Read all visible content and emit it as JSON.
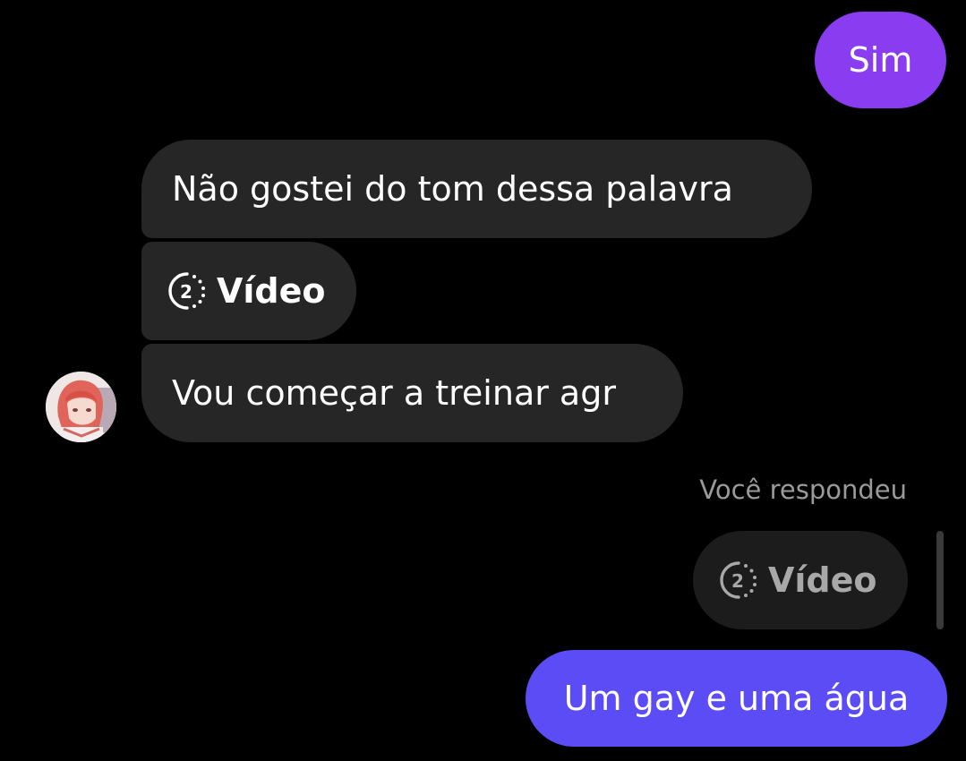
{
  "messages": {
    "outgoing_1": {
      "text": "Sim"
    },
    "incoming_1": {
      "text": "Não gostei do tom dessa palavra"
    },
    "incoming_2": {
      "icon": "view-once-2-icon",
      "text": "Vídeo"
    },
    "incoming_3": {
      "text": "Vou começar a treinar agr"
    },
    "reply": {
      "label": "Você respondeu",
      "icon": "view-once-2-icon",
      "text": "Vídeo"
    },
    "outgoing_2": {
      "text": "Um gay e uma água"
    }
  },
  "view_once_count": "2",
  "colors": {
    "background": "#000000",
    "incoming_bubble": "#262626",
    "reply_bubble": "#1c1c1c",
    "outgoing_top": "#8a3cf0",
    "outgoing_bottom": "#5b4cf5",
    "muted_text": "#9a9a9a"
  },
  "avatar": {
    "icon": "anime-girl-avatar"
  }
}
